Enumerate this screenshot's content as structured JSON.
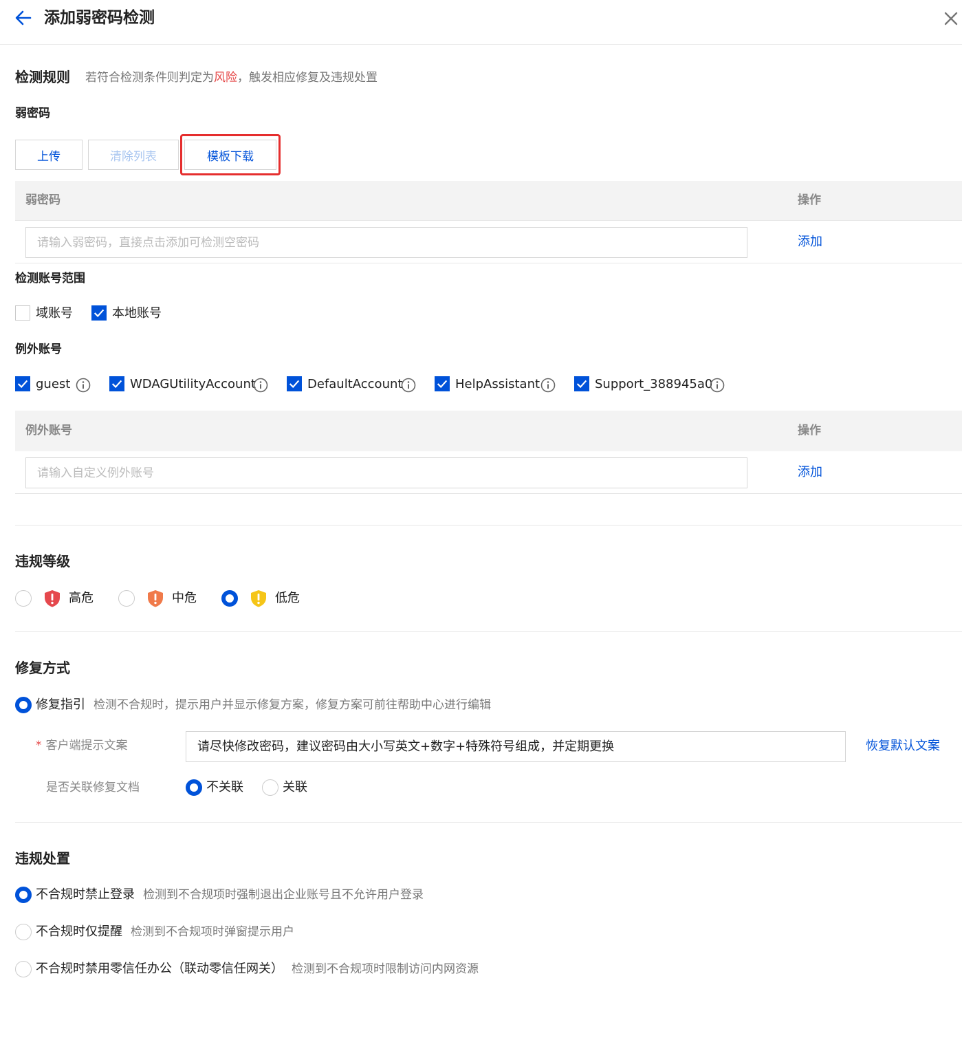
{
  "header": {
    "title": "添加弱密码检测"
  },
  "rules": {
    "title": "检测规则",
    "desc_prefix": "若符合检测条件则判定为",
    "desc_risk": "风险",
    "desc_suffix": "，触发相应修复及违规处置",
    "colors": {
      "risk": "#e54545",
      "accent": "#0052d9",
      "highlight": "#e52e2e"
    }
  },
  "weak_password": {
    "label": "弱密码",
    "upload_btn": "上传",
    "clear_btn": "清除列表",
    "template_btn": "模板下载",
    "table": {
      "col_password": "弱密码",
      "col_action": "操作",
      "input_placeholder": "请输入弱密码，直接点击添加可检测空密码",
      "add_link": "添加"
    }
  },
  "account_scope": {
    "label": "检测账号范围",
    "options": [
      {
        "label": "域账号",
        "checked": false
      },
      {
        "label": "本地账号",
        "checked": true
      }
    ]
  },
  "exception_accounts": {
    "label": "例外账号",
    "accounts": [
      {
        "label": "guest",
        "checked": true,
        "icon": "info-icon"
      },
      {
        "label": "WDAGUtilityAccount",
        "checked": true,
        "icon": "info-icon"
      },
      {
        "label": "DefaultAccount",
        "checked": true,
        "icon": "info-icon"
      },
      {
        "label": "HelpAssistant",
        "checked": true,
        "icon": "info-icon"
      },
      {
        "label": "Support_388945a0",
        "checked": true,
        "icon": "info-icon"
      }
    ],
    "table": {
      "col_account": "例外账号",
      "col_action": "操作",
      "input_placeholder": "请输入自定义例外账号",
      "add_link": "添加"
    }
  },
  "violation_level": {
    "title": "违规等级",
    "options": [
      {
        "label": "高危",
        "selected": false,
        "icon": "high-risk-shield-icon",
        "color": "#e5484d"
      },
      {
        "label": "中危",
        "selected": false,
        "icon": "medium-risk-shield-icon",
        "color": "#f07a4a"
      },
      {
        "label": "低危",
        "selected": true,
        "icon": "low-risk-shield-icon",
        "color": "#f5c518"
      }
    ]
  },
  "repair": {
    "title": "修复方式",
    "option_label": "修复指引",
    "option_desc": "检测不合规时，提示用户并显示修复方案，修复方案可前往帮助中心进行编辑",
    "client_tip_label": "客户端提示文案",
    "client_tip_required": "*",
    "client_tip_value": "请尽快修改密码，建议密码由大小写英文+数字+特殊符号组成，并定期更换",
    "restore_link": "恢复默认文案",
    "link_doc_label": "是否关联修复文档",
    "link_doc_options": [
      {
        "label": "不关联",
        "selected": true
      },
      {
        "label": "关联",
        "selected": false
      }
    ]
  },
  "disposal": {
    "title": "违规处置",
    "options": [
      {
        "label": "不合规时禁止登录",
        "desc": "检测到不合规项时强制退出企业账号且不允许用户登录",
        "selected": true
      },
      {
        "label": "不合规时仅提醒",
        "desc": "检测到不合规项时弹窗提示用户",
        "selected": false
      },
      {
        "label": "不合规时禁用零信任办公（联动零信任网关）",
        "desc": "检测到不合规项时限制访问内网资源",
        "selected": false
      }
    ]
  }
}
